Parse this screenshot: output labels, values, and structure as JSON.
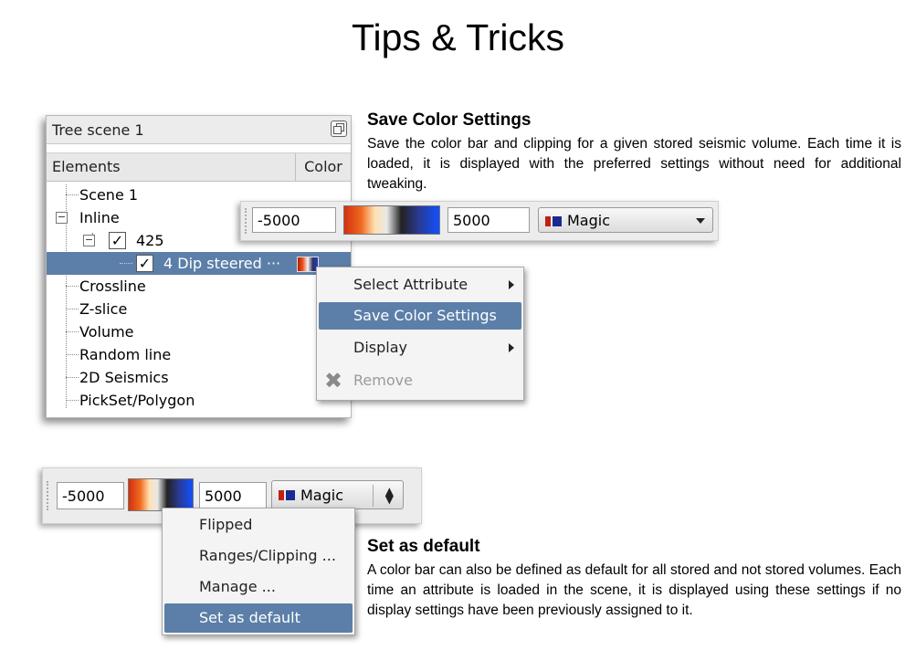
{
  "slide": {
    "title": "Tips & Tricks",
    "section1": {
      "heading": "Save Color Settings",
      "text": "Save the color bar and clipping for a given stored seismic volume. Each time it is loaded, it is displayed with the preferred settings without need for additional tweaking."
    },
    "section2": {
      "heading": "Set as default",
      "text": "A color bar can also be defined as default for all  stored and not stored volumes. Each time an attribute is loaded in the scene, it is displayed using these settings if no display settings have been previously assigned to it."
    }
  },
  "tree": {
    "title": "Tree scene 1",
    "col_elements": "Elements",
    "col_color": "Color",
    "items": {
      "scene": "Scene 1",
      "inline": "Inline",
      "inline_425": "425",
      "dip_steered": "4 Dip steered ···",
      "crossline": "Crossline",
      "zslice": "Z-slice",
      "volume": "Volume",
      "random_line": "Random line",
      "seismics2d": "2D Seismics",
      "pickset": "PickSet/Polygon"
    }
  },
  "context_menu": {
    "items": [
      "Select Attribute",
      "Save Color Settings",
      "Display",
      "Remove"
    ]
  },
  "toolbar_top": {
    "min": "-5000",
    "max": "5000",
    "colortable": "Magic"
  },
  "toolbar_bottom": {
    "min": "-5000",
    "max": "5000",
    "colortable": "Magic"
  },
  "colorbar_menu": {
    "items": [
      "Flipped",
      "Ranges/Clipping ...",
      "Manage ...",
      "Set as default"
    ]
  },
  "colors": {
    "selection": "#5b7fa8"
  }
}
